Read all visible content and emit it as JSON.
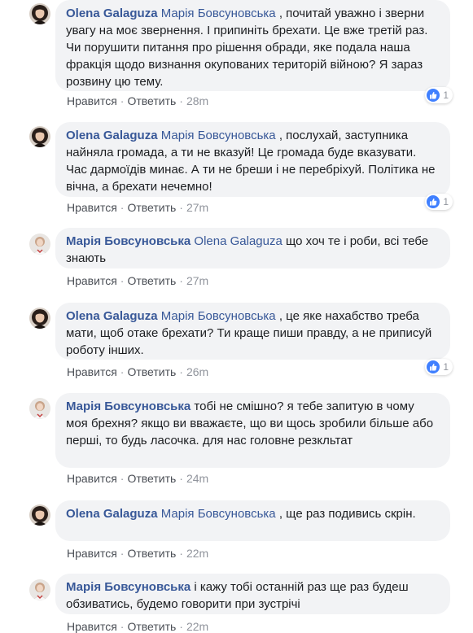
{
  "actions": {
    "like": "Нравится",
    "reply": "Ответить",
    "sep": "·"
  },
  "comments": [
    {
      "author": "Olena Galaguza",
      "mention": "Марія Бовсуновська",
      "text": " , почитай уважно і зверни увагу на моє звернення. І припиніть брехати. Це вже третій раз. Чи порушити питання про рішення обради, яке подала наша фракція щодо визнання окупованих територій війною? Я зараз розвину цю тему.",
      "time": "28m",
      "likes": "1"
    },
    {
      "author": "Olena Galaguza",
      "mention": "Марія Бовсуновська",
      "text": " , послухай, заступника найняла громада, а ти не вказуй! Це громада буде вказувати. Час дармоїдів минає. А ти не бреши і не перебріхуй. Політика не вічна, а брехати нечемно!",
      "time": "27m",
      "likes": "1"
    },
    {
      "author": "Марія Бовсуновська",
      "mention": "Olena Galaguza",
      "text": " що хоч те і роби, всі тебе знають",
      "time": "27m",
      "likes": ""
    },
    {
      "author": "Olena Galaguza",
      "mention": "Марія Бовсуновська",
      "text": " , це яке нахабство треба мати, щоб отаке брехати? Ти краще пиши правду, а не приписуй роботу інших.",
      "time": "26m",
      "likes": "1"
    },
    {
      "author": "Марія Бовсуновська",
      "mention": "",
      "text": " тобі не смішно? я тебе запитую в чому моя брехня? якщо ви вважаєте, що ви щось зробили більше або перші, то будь ласочка. для нас головне резкльтат",
      "time": "24m",
      "likes": ""
    },
    {
      "author": "Olena Galaguza",
      "mention": "Марія Бовсуновська",
      "text": " , ще раз подивись скрін.",
      "time": "22m",
      "likes": ""
    },
    {
      "author": "Марія Бовсуновська",
      "mention": "",
      "text": " і кажу тобі останній раз ще раз будеш обзиватись, будемо говорити при зустрічі",
      "time": "22m",
      "likes": ""
    }
  ]
}
